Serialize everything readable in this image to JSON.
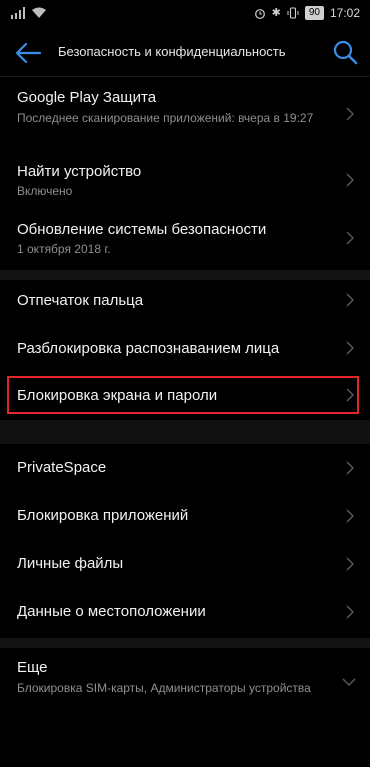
{
  "status_bar": {
    "battery": "90",
    "time": "17:02"
  },
  "toolbar": {
    "title": "Безопасность и конфиденциальность"
  },
  "items": [
    {
      "label": "Google Play Защита",
      "sub": "Последнее сканирование приложений: вчера в 19:27"
    },
    {
      "label": "Найти устройство",
      "sub": "Включено"
    },
    {
      "label": "Обновление системы безопасности",
      "sub": "1 октября 2018 г."
    },
    {
      "label": "Отпечаток пальца"
    },
    {
      "label": "Разблокировка распознаванием лица"
    },
    {
      "label": "Блокировка экрана и пароли"
    },
    {
      "label": "PrivateSpace"
    },
    {
      "label": "Блокировка приложений"
    },
    {
      "label": "Личные файлы"
    },
    {
      "label": "Данные о местоположении"
    },
    {
      "label": "Еще",
      "sub": "Блокировка SIM-карты, Администраторы устройства"
    }
  ],
  "colors": {
    "accent": "#3a8eea",
    "highlight": "#e3262c",
    "background": "#000000"
  }
}
